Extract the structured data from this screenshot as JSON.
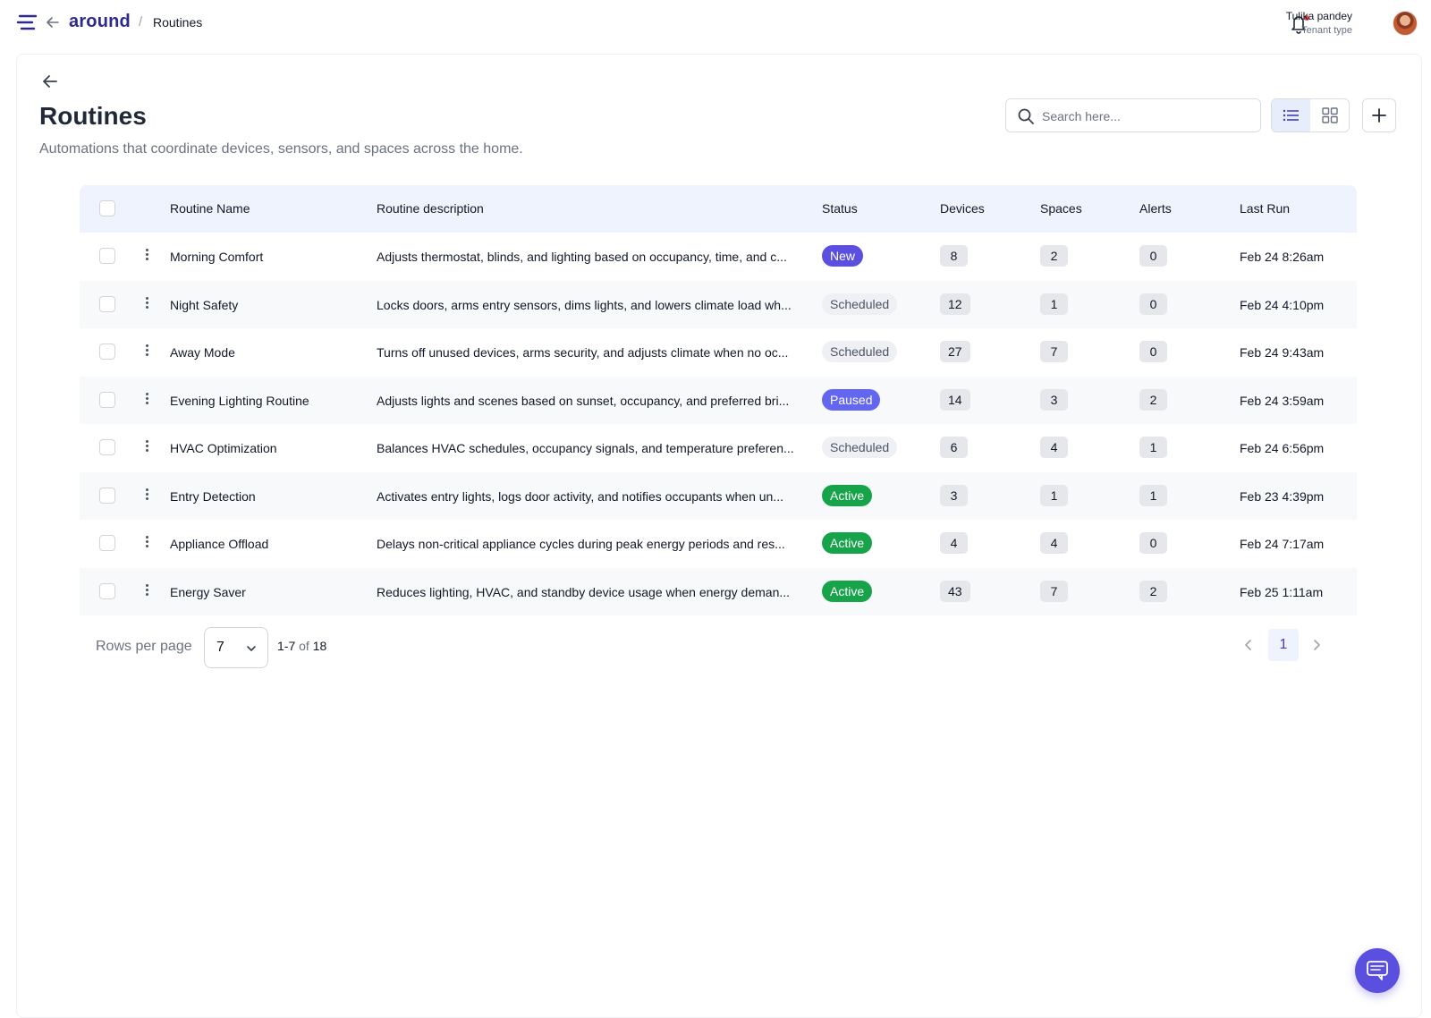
{
  "header": {
    "logo": "around",
    "breadcrumb_separator": "/",
    "breadcrumb": "Routines",
    "user_name": "Tulika pandey",
    "user_role": "Tenant type"
  },
  "page": {
    "title": "Routines",
    "subtitle": "Automations that coordinate devices, sensors, and spaces across the home.",
    "search_placeholder": "Search here..."
  },
  "table": {
    "columns": [
      "Routine Name",
      "Routine description",
      "Status",
      "Devices",
      "Spaces",
      "Alerts",
      "Last Run"
    ],
    "rows": [
      {
        "name": "Morning Comfort",
        "description": "Adjusts thermostat, blinds, and lighting based on occupancy, time, and c...",
        "status": "New",
        "devices": "8",
        "spaces": "2",
        "alerts": "0",
        "last_run": "Feb 24 8:26am"
      },
      {
        "name": "Night Safety",
        "description": "Locks doors, arms entry sensors, dims lights, and lowers climate load wh...",
        "status": "Scheduled",
        "devices": "12",
        "spaces": "1",
        "alerts": "0",
        "last_run": "Feb 24 4:10pm"
      },
      {
        "name": "Away Mode",
        "description": "Turns off unused devices, arms security, and adjusts climate when no oc...",
        "status": "Scheduled",
        "devices": "27",
        "spaces": "7",
        "alerts": "0",
        "last_run": "Feb 24 9:43am"
      },
      {
        "name": "Evening Lighting Routine",
        "description": "Adjusts lights and scenes based on sunset, occupancy, and preferred bri...",
        "status": "Paused",
        "devices": "14",
        "spaces": "3",
        "alerts": "2",
        "last_run": "Feb 24 3:59am"
      },
      {
        "name": "HVAC Optimization",
        "description": "Balances HVAC schedules, occupancy signals, and temperature preferen...",
        "status": "Scheduled",
        "devices": "6",
        "spaces": "4",
        "alerts": "1",
        "last_run": "Feb 24 6:56pm"
      },
      {
        "name": "Entry Detection",
        "description": "Activates entry lights, logs door activity, and notifies occupants when un...",
        "status": "Active",
        "devices": "3",
        "spaces": "1",
        "alerts": "1",
        "last_run": "Feb 23 4:39pm"
      },
      {
        "name": "Appliance Offload",
        "description": "Delays non-critical appliance cycles during peak energy periods and res...",
        "status": "Active",
        "devices": "4",
        "spaces": "4",
        "alerts": "0",
        "last_run": "Feb 24 7:17am"
      },
      {
        "name": "Energy Saver",
        "description": "Reduces lighting, HVAC, and standby device usage when energy deman...",
        "status": "Active",
        "devices": "43",
        "spaces": "7",
        "alerts": "2",
        "last_run": "Feb 25 1:11am"
      }
    ]
  },
  "footer": {
    "rows_per_page_label": "Rows per page",
    "rows_per_page_value": "7",
    "range": "1-7",
    "range_of": "of",
    "total": "18",
    "current_page": "1"
  },
  "colors": {
    "brand": "#2d2a8c",
    "accent": "#5b4fe0",
    "status_new": "#5b4fe0",
    "status_paused": "#6366f1",
    "status_active": "#16a34a",
    "status_scheduled": "#eef0f3",
    "header_bg": "#eef3fd"
  },
  "icons": {
    "menu": "menu-icon",
    "back": "arrow-left-icon",
    "bell": "bell-icon",
    "search": "search-icon",
    "list_view": "list-view-icon",
    "grid_view": "grid-view-icon",
    "add": "plus-icon",
    "row_menu": "more-vertical-icon",
    "chat": "chat-icon"
  }
}
